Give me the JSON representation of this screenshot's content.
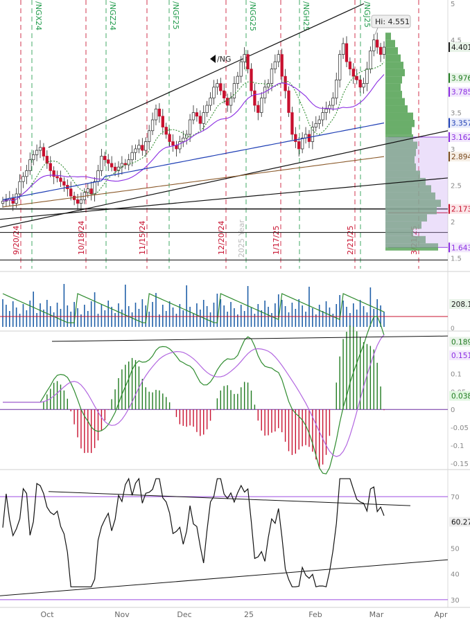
{
  "chart_data": {
    "type": "candlestick",
    "symbol": "/NG",
    "hi_label": "Hi: 4.551",
    "x_axis": {
      "labels": [
        "Oct",
        "Nov",
        "Dec",
        "25",
        "Feb",
        "Mar",
        "Apr"
      ],
      "date_markers": [
        "9/20/24",
        "10/18/24",
        "11/15/24",
        "12/20/24",
        "1/17/25",
        "2/21/25",
        "3/21/25"
      ],
      "contract_markers": [
        "/NGX24",
        "/NGZ24",
        "/NGF25",
        "/NGG25",
        "/NGH25",
        "/NGJ25"
      ],
      "year_marker": "2025 Year"
    },
    "price_panel": {
      "ylim": [
        1.35,
        5.05
      ],
      "ticks": [
        "5",
        "4.5",
        "4",
        "3.5",
        "3",
        "2.5",
        "2",
        "1.5"
      ],
      "tick_values": [
        5,
        4.5,
        4,
        3.5,
        3,
        2.5,
        2,
        1.5
      ],
      "last_price": 4.401,
      "level_labels": [
        {
          "value": 4.401,
          "label": "4.401",
          "color": "#1a1a1a",
          "bg": "#e8f3e8"
        },
        {
          "value": 3.976,
          "label": "3.976",
          "color": "#1f7a1f",
          "bg": "#e9f5e9"
        },
        {
          "value": 3.785,
          "label": "3.785",
          "color": "#8a2be2",
          "bg": "#f2e8fc"
        },
        {
          "value": 3.357,
          "label": "3.357",
          "color": "#1f3fb5",
          "bg": "#e8ecfb"
        },
        {
          "value": 3.162,
          "label": "3.162",
          "color": "#8a2be2",
          "bg": "#f2e8fc"
        },
        {
          "value": 2.894,
          "label": "2.894",
          "color": "#7a4a1f",
          "bg": "#f6efe6"
        },
        {
          "value": 2.173,
          "label": "2.173",
          "color": "#c8102e",
          "bg": "#fbe6e8"
        },
        {
          "value": 1.643,
          "label": "1.643",
          "color": "#8a2be2",
          "bg": "#f2e8fc"
        }
      ],
      "close_series": [
        2.28,
        2.3,
        2.32,
        2.25,
        2.38,
        2.55,
        2.62,
        2.7,
        2.85,
        2.92,
        2.98,
        3.02,
        2.9,
        2.8,
        2.7,
        2.62,
        2.6,
        2.55,
        2.5,
        2.45,
        2.35,
        2.3,
        2.25,
        2.3,
        2.4,
        2.45,
        2.38,
        2.55,
        2.7,
        2.9,
        2.85,
        2.8,
        2.75,
        2.7,
        2.75,
        2.8,
        2.78,
        2.85,
        2.95,
        3.0,
        3.05,
        2.98,
        3.1,
        3.25,
        3.4,
        3.55,
        3.45,
        3.3,
        3.2,
        3.1,
        3.05,
        3.0,
        3.1,
        3.15,
        3.2,
        3.4,
        3.5,
        3.45,
        3.35,
        3.5,
        3.6,
        3.7,
        3.85,
        3.9,
        3.8,
        3.7,
        3.6,
        3.7,
        3.9,
        4.0,
        4.2,
        4.3,
        4.1,
        3.8,
        3.6,
        3.5,
        3.7,
        3.85,
        3.9,
        4.1,
        4.2,
        4.3,
        4.0,
        3.8,
        3.5,
        3.2,
        3.1,
        3.0,
        3.15,
        3.2,
        3.1,
        3.3,
        3.35,
        3.4,
        3.5,
        3.55,
        3.6,
        3.7,
        3.95,
        4.3,
        4.45,
        4.2,
        4.1,
        4.0,
        3.95,
        3.85,
        3.9,
        4.1,
        4.35,
        4.5,
        4.4,
        4.3,
        4.401
      ]
    },
    "volume_panel": {
      "last_label": "208.1"
    },
    "macd_panel": {
      "ylim": [
        -0.16,
        0.215
      ],
      "ticks": [
        "0.1",
        "0.05",
        "0",
        "-0.05",
        "-0.1",
        "-0.15"
      ],
      "tick_values": [
        0.1,
        0.05,
        0,
        -0.05,
        -0.1,
        -0.15
      ],
      "macd_last_label": "0.189",
      "signal_last_label": "0.151",
      "hist_last_label": "0.038"
    },
    "rsi_panel": {
      "ylim": [
        27,
        80
      ],
      "ticks": [
        "70",
        "60",
        "50",
        "40",
        "30"
      ],
      "tick_values": [
        70,
        60,
        50,
        40,
        30
      ],
      "last_label": "60.27",
      "upper_band": 70,
      "lower_band": 30
    },
    "colors": {
      "up": "#1f7a1f",
      "down": "#c8102e",
      "ma_green": "#2e8b2e",
      "ma_purple": "#8a2be2",
      "ma_blue": "#1f3fb5",
      "ma_brown": "#8b5a2b",
      "volume_profile": "#5aa55a",
      "volume_profile_hl": "#c9a6f0",
      "vertical_red": "#c8102e",
      "vertical_green": "#1f9a4a",
      "trend_line": "#111111",
      "macd_line": "#2e8b2e",
      "signal_line": "#b266e0",
      "rsi_line": "#111111",
      "rsi_band": "#9b4ae0",
      "volume_bar": "#1f5fa8"
    }
  }
}
